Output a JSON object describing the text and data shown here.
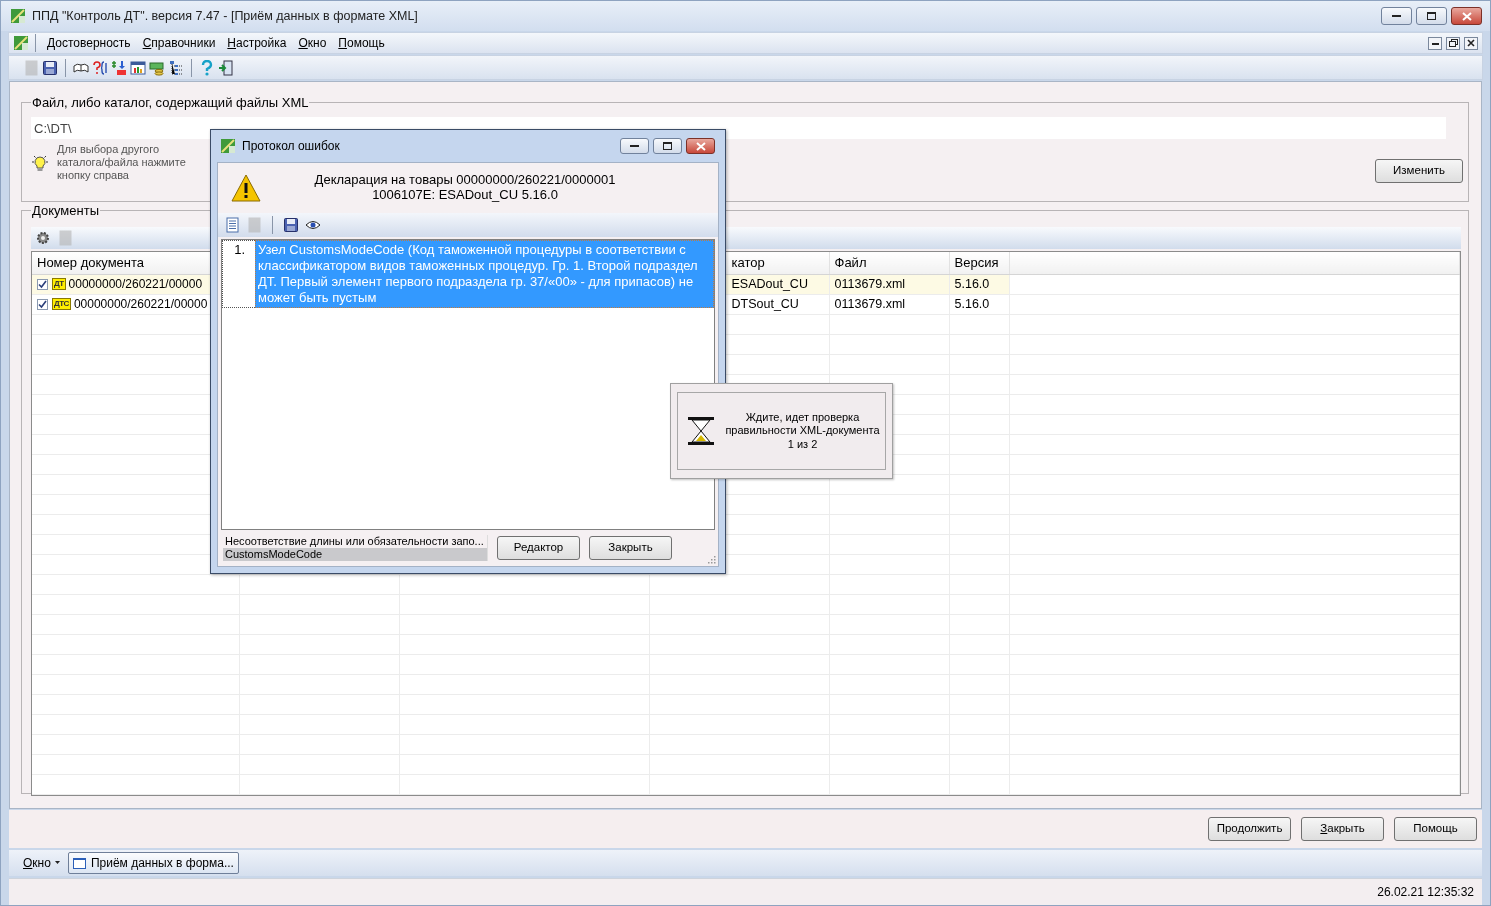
{
  "window": {
    "title": "ППД \"Контроль ДТ\". версия 7.47 - [Приём данных в формате XML]"
  },
  "menu": [
    "Достоверность",
    "Справочники",
    "Настройка",
    "Окно",
    "Помощь"
  ],
  "toolbar": [
    {
      "kind": "document",
      "disabled": true
    },
    {
      "kind": "save",
      "disabled": false
    },
    {
      "kind": "separator"
    },
    {
      "kind": "book",
      "disabled": false
    },
    {
      "kind": "code",
      "disabled": false
    },
    {
      "kind": "conversion",
      "disabled": false
    },
    {
      "kind": "chart",
      "disabled": false
    },
    {
      "kind": "money",
      "disabled": false
    },
    {
      "kind": "tree",
      "disabled": false
    },
    {
      "kind": "separator"
    },
    {
      "kind": "help",
      "disabled": false
    },
    {
      "kind": "exit",
      "disabled": false
    }
  ],
  "file_group": {
    "title": "Файл, либо каталог, содержащий файлы XML",
    "path": "C:\\DT\\",
    "hint": "Для выбора другого каталога/файла нажмите кнопку справа",
    "change_button": "Изменить"
  },
  "documents": {
    "title": "Документы",
    "toolbar": [
      {
        "kind": "gear",
        "disabled": false
      },
      {
        "kind": "document",
        "disabled": true
      }
    ],
    "columns": [
      "Номер документа",
      "катор",
      "Файл",
      "Версия"
    ],
    "rows": [
      {
        "checked": true,
        "selected": true,
        "doc_type": "ДТ",
        "number": "00000000/260221/00000",
        "column_2": "ESADout_CU",
        "file": "0113679.xml",
        "version": "5.16.0"
      },
      {
        "checked": true,
        "selected": false,
        "doc_type": "ДТС",
        "number": "00000000/260221/00000",
        "column_2": "DTSout_CU",
        "file": "0113679.xml",
        "version": "5.16.0"
      }
    ]
  },
  "buttons": [
    "Продолжить",
    "Закрыть",
    "Помощь"
  ],
  "taskbar": {
    "menu": "Окно",
    "tabs": [
      {
        "label": "Приём данных в форма...",
        "selected": true
      }
    ]
  },
  "status_bar": {
    "datetime": "26.02.21 12:35:32"
  },
  "error_dialog": {
    "title": "Протокол ошибок",
    "heading": [
      "Декларация на товары 00000000/260221/0000001",
      "1006107E: ESADout_CU 5.16.0"
    ],
    "toolbar": [
      {
        "kind": "document",
        "disabled": false
      },
      {
        "kind": "document",
        "disabled": true
      },
      {
        "kind": "separator"
      },
      {
        "kind": "save",
        "disabled": false
      },
      {
        "kind": "eye",
        "disabled": false
      }
    ],
    "errors": [
      {
        "number": "1.",
        "text": "Узел CustomsModeCode (Код таможенной процедуры в соответствии с классификатором видов таможенных процедур. Гр. 1. Второй подраздел ДТ. Первый элемент первого подраздела гр. 37/«00» - для припасов) не может быть пустым",
        "selected": true
      }
    ],
    "status_lines": [
      {
        "text": "Несоответствие длины или обязательности запо...",
        "selected": false
      },
      {
        "text": "CustomsModeCode",
        "selected": true
      }
    ],
    "buttons": [
      "Редактор",
      "Закрыть"
    ]
  },
  "wait_popup": {
    "lines": [
      "Ждите, идет проверка",
      "правильности XML-документа",
      "1 из 2"
    ]
  }
}
